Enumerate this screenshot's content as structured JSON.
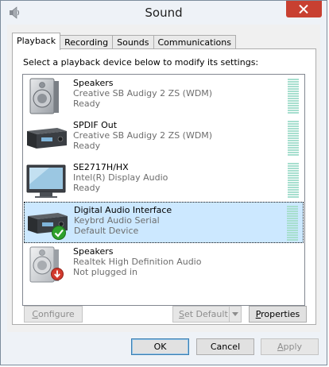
{
  "window": {
    "title": "Sound"
  },
  "tabs": [
    {
      "label": "Playback"
    },
    {
      "label": "Recording"
    },
    {
      "label": "Sounds"
    },
    {
      "label": "Communications"
    }
  ],
  "panel": {
    "instruction": "Select a playback device below to modify its settings:",
    "devices": [
      {
        "name": "Speakers",
        "driver": "Creative SB Audigy 2 ZS (WDM)",
        "status": "Ready",
        "icon": "speaker-icon"
      },
      {
        "name": "SPDIF Out",
        "driver": "Creative SB Audigy 2 ZS (WDM)",
        "status": "Ready",
        "icon": "receiver-icon"
      },
      {
        "name": "SE2717H/HX",
        "driver": "Intel(R) Display Audio",
        "status": "Ready",
        "icon": "monitor-icon"
      },
      {
        "name": "Digital Audio Interface",
        "driver": "Keybrd Audio Serial",
        "status": "Default Device",
        "icon": "receiver-icon",
        "selected": true
      },
      {
        "name": "Speakers",
        "driver": "Realtek High Definition Audio",
        "status": "Not plugged in",
        "icon": "speaker-icon"
      }
    ],
    "buttons": {
      "configure": {
        "first": "C",
        "rest": "onfigure"
      },
      "set_default": {
        "first": "S",
        "rest": "et Default"
      },
      "properties": {
        "first": "P",
        "rest": "roperties"
      }
    }
  },
  "footer": {
    "ok": "OK",
    "cancel": "Cancel",
    "apply": {
      "first": "A",
      "rest": "pply"
    }
  },
  "colors": {
    "selection": "#cce8ff",
    "meter": "#a7dfcf",
    "close_button": "#c84031"
  }
}
